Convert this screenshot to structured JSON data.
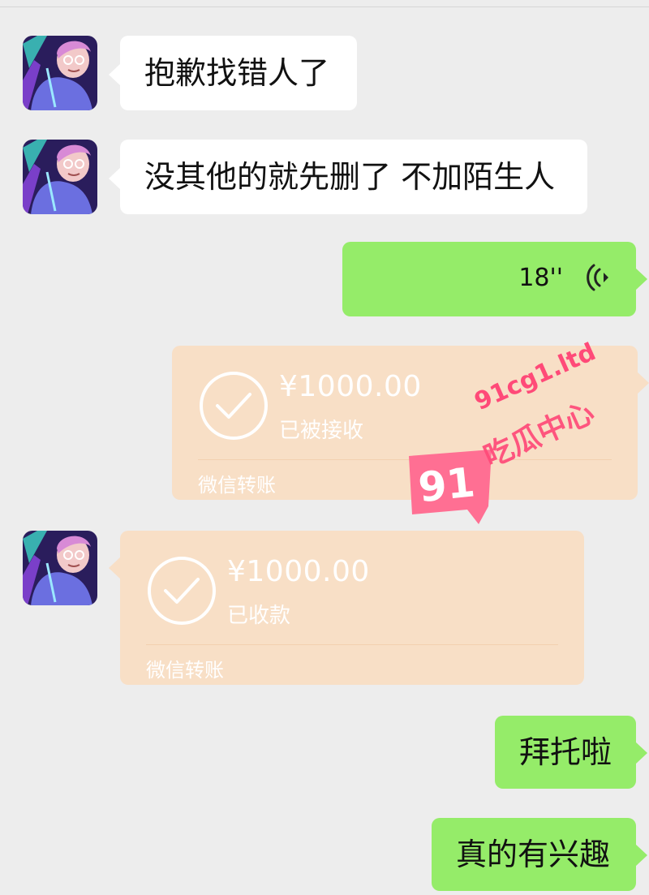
{
  "messages": {
    "m1": {
      "text": "抱歉找错人了"
    },
    "m2": {
      "text": "没其他的就先删了 不加陌生人"
    },
    "voice": {
      "duration": "18''",
      "icon": "voice-waves-icon"
    },
    "transfer_sent": {
      "amount": "¥1000.00",
      "status": "已被接收",
      "source": "微信转账",
      "icon": "check-circle-icon"
    },
    "transfer_received": {
      "amount": "¥1000.00",
      "status": "已收款",
      "source": "微信转账",
      "icon": "check-circle-icon"
    },
    "m3": {
      "text": "拜托啦"
    },
    "m4": {
      "text": "真的有兴趣"
    }
  },
  "watermark": {
    "site": "91cg1.ltd",
    "name": "吃瓜中心",
    "logo": "91"
  },
  "colors": {
    "background": "#ededed",
    "incoming_bubble": "#ffffff",
    "outgoing_bubble": "#95ec69",
    "transfer_bubble": "#f8dfc6",
    "watermark": "#ff4a78"
  }
}
